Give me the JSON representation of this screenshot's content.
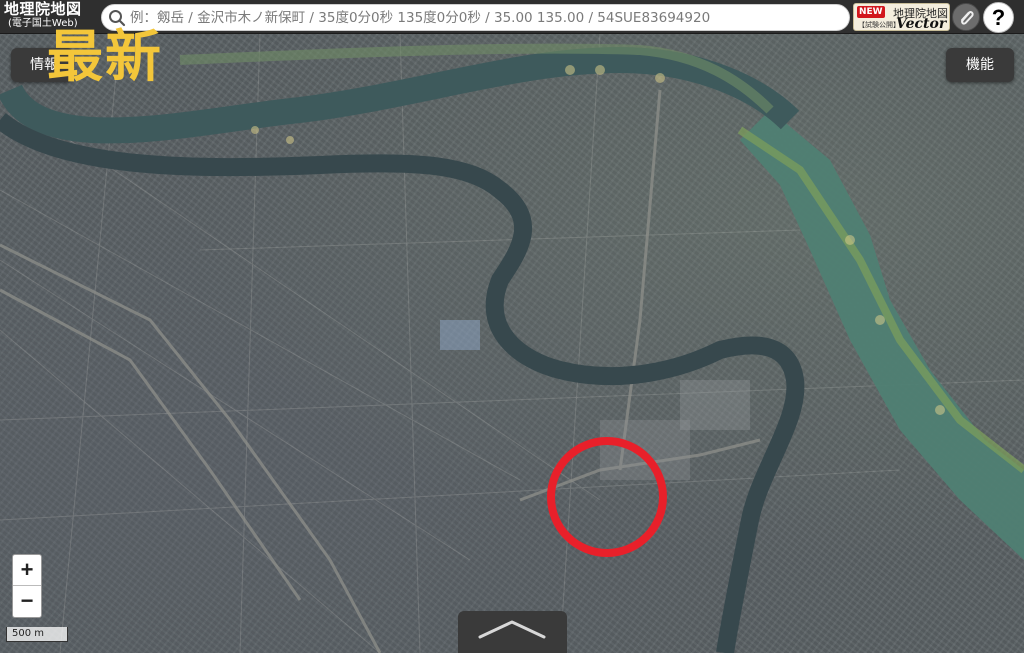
{
  "header": {
    "logo_main": "地理院地図",
    "logo_sub": "(電子国土Web)",
    "search_placeholder": "例：剱岳 / 金沢市木ノ新保町 / 35度0分0秒 135度0分0秒 / 35.00 135.00 / 54SUE83694920",
    "vector_button": {
      "badge": "NEW",
      "small": "【試験公開】",
      "title": "地理院地図",
      "label": "Vector"
    },
    "link_icon": "paperclip-icon",
    "help_label": "?"
  },
  "overlay": {
    "info_label": "情報",
    "function_label": "機能",
    "stamp_text": "最新",
    "zoom_in": "+",
    "zoom_out": "−",
    "scale": "500 m"
  },
  "map": {
    "type": "aerial-photo",
    "annotation_color": "#e8202a",
    "river_color": "#3a4f55",
    "wide_river_color": "#4d7a70"
  }
}
